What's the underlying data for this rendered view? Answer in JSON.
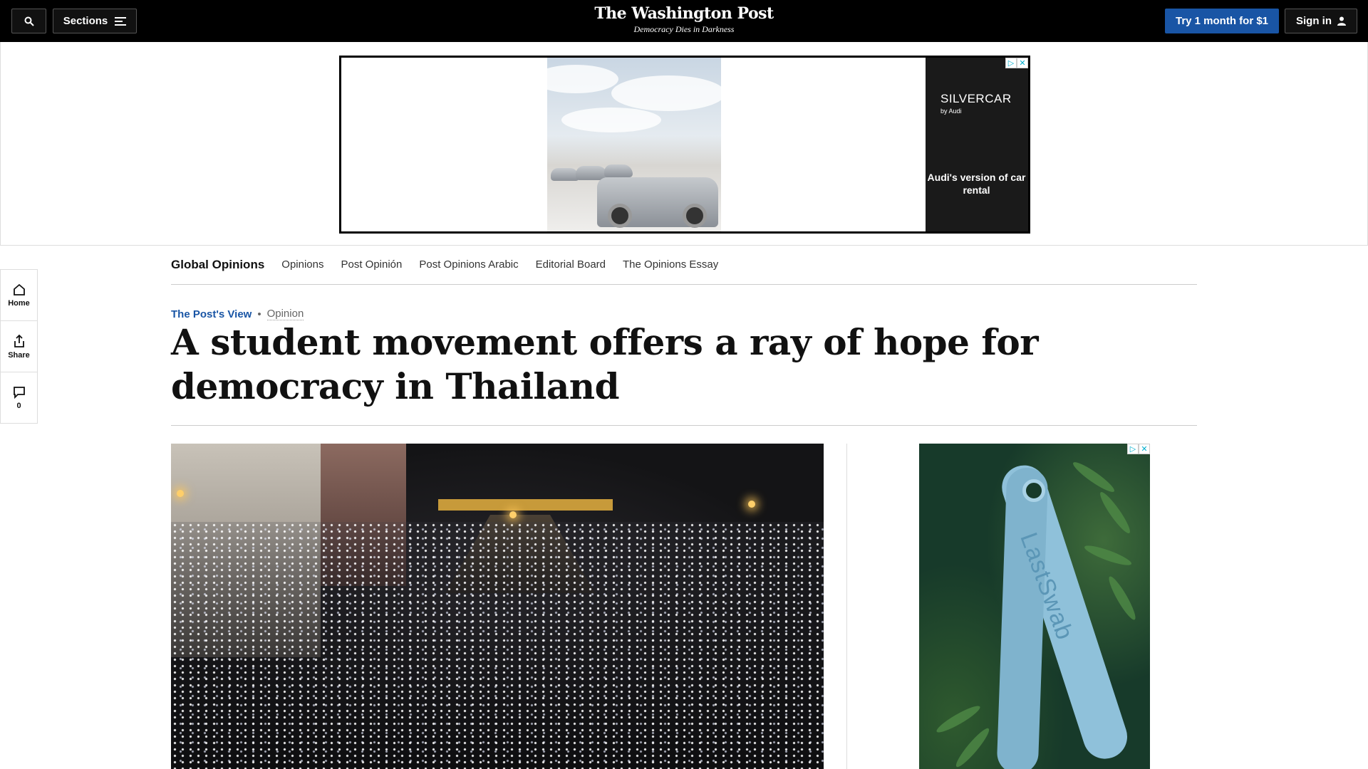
{
  "header": {
    "sections_label": "Sections",
    "logo_text": "The Washington Post",
    "tagline": "Democracy Dies in Darkness",
    "subscribe_label": "Try 1 month for $1",
    "signin_label": "Sign in"
  },
  "top_ad": {
    "brand": "SILVERCAR",
    "subbrand": "by Audi",
    "copy": "Audi's version of car rental"
  },
  "section_nav": {
    "current": "Global Opinions",
    "items": [
      "Opinions",
      "Post Opinión",
      "Post Opinions Arabic",
      "Editorial Board",
      "The Opinions Essay"
    ]
  },
  "side_rail": {
    "home_label": "Home",
    "share_label": "Share",
    "comments_count": "0"
  },
  "article": {
    "kicker_label": "The Post's View",
    "kicker_section": "Opinion",
    "headline": "A student movement offers a ray of hope for democracy in Thailand"
  },
  "right_ad": {
    "product_text": "LastSwab"
  },
  "icons": [
    "search-icon",
    "menu-icon",
    "user-icon",
    "home-icon",
    "share-icon",
    "comment-icon",
    "adchoices-icon",
    "close-icon"
  ],
  "colors": {
    "topbar": "#000000",
    "accent": "#1955a5"
  }
}
